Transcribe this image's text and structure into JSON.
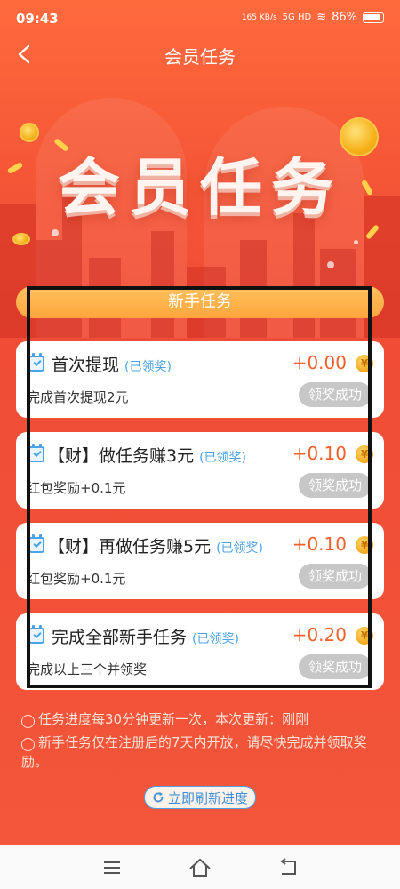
{
  "status_bar": {
    "time": "09:43",
    "net_speed": "165 KB/s",
    "signal": "5G HD",
    "battery": "86%"
  },
  "header": {
    "title": "会员任务",
    "back_icon": "chevron-left-icon"
  },
  "banner": {
    "title": "会员任务"
  },
  "section": {
    "label": "新手任务"
  },
  "tasks": [
    {
      "name": "首次提现",
      "status": "(已领奖)",
      "amount": "+0.00",
      "desc": "完成首次提现2元",
      "button": "领奖成功"
    },
    {
      "name": "【财】做任务赚3元",
      "status": "(已领奖)",
      "amount": "+0.10",
      "desc": "红包奖励+0.1元",
      "button": "领奖成功"
    },
    {
      "name": "【财】再做任务赚5元",
      "status": "(已领奖)",
      "amount": "+0.10",
      "desc": "红包奖励+0.1元",
      "button": "领奖成功"
    },
    {
      "name": "完成全部新手任务",
      "status": "(已领奖)",
      "amount": "+0.20",
      "desc": "完成以上三个并领奖",
      "button": "领奖成功"
    }
  ],
  "notes": [
    "任务进度每30分钟更新一次，本次更新：刚刚",
    "新手任务仅在注册后的7天内开放，请尽快完成并领取奖励。"
  ],
  "refresh_button": "立即刷新进度",
  "coin_glyph": "¥",
  "colors": {
    "accent": "#f3563a",
    "tab": "#ffa53c",
    "amount": "#f0602a",
    "link": "#4aa3e8",
    "done_button": "#c7c7c7"
  }
}
